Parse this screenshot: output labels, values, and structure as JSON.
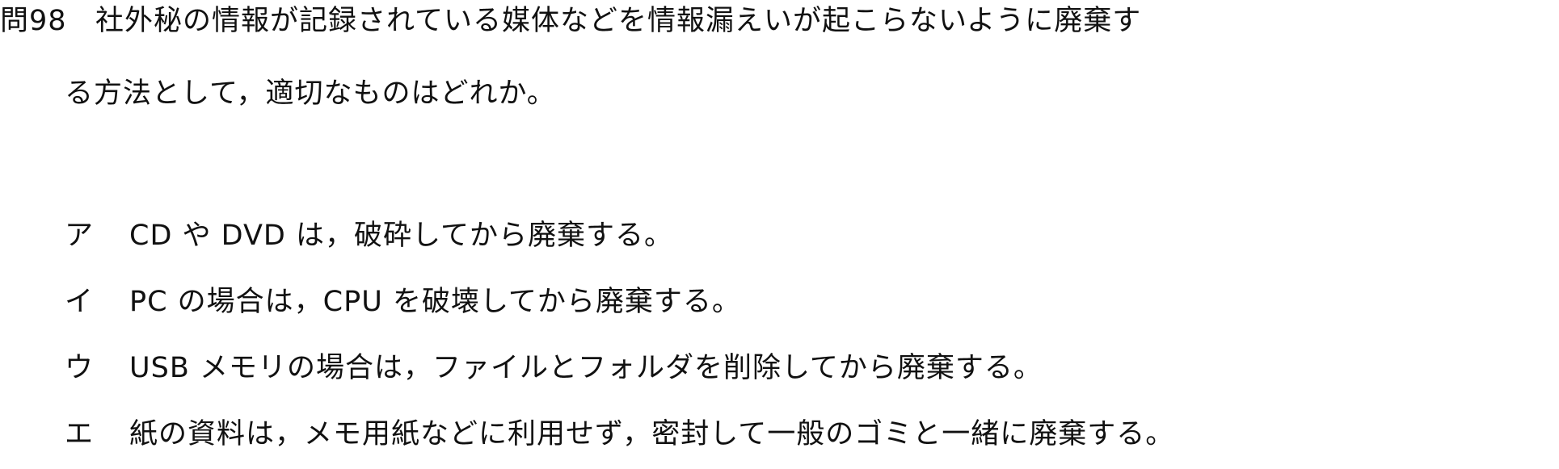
{
  "question": {
    "number": "問98",
    "text_line1": "社外秘の情報が記録されている媒体などを情報漏えいが起こらないように廃棄す",
    "text_line2": "る方法として，適切なものはどれか。"
  },
  "choices": [
    {
      "letter": "ア",
      "text": "CD や DVD は，破砕してから廃棄する。"
    },
    {
      "letter": "イ",
      "text": "PC の場合は，CPU を破壊してから廃棄する。"
    },
    {
      "letter": "ウ",
      "text": "USB メモリの場合は，ファイルとフォルダを削除してから廃棄する。"
    },
    {
      "letter": "エ",
      "text": "紙の資料は，メモ用紙などに利用せず，密封して一般のゴミと一緒に廃棄する。"
    }
  ]
}
